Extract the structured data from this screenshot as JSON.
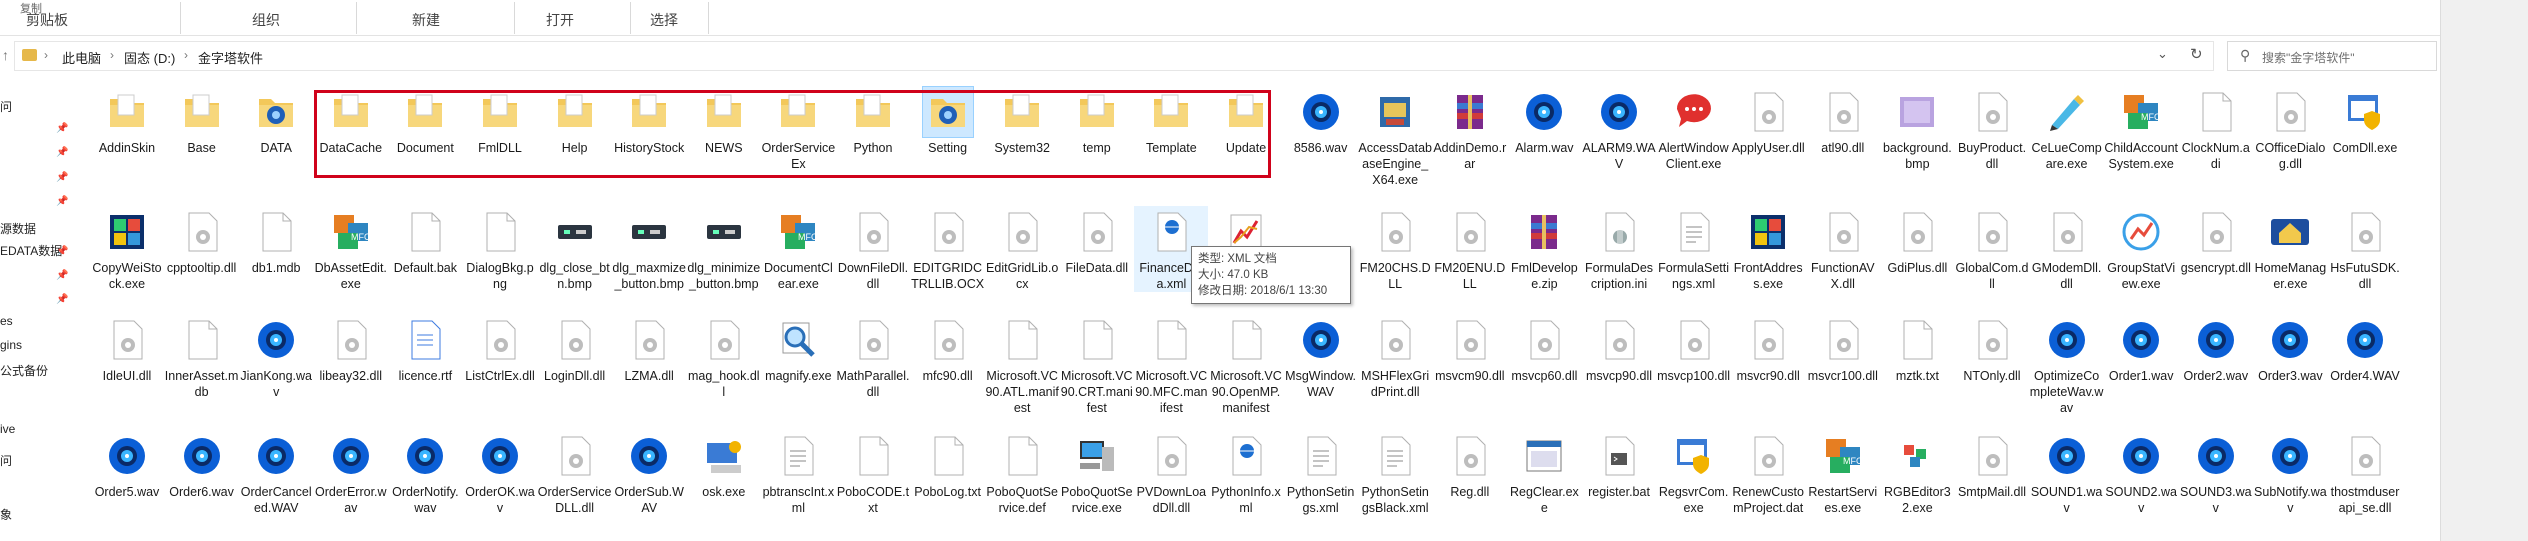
{
  "ribbon": {
    "groups": [
      "剪贴板",
      "组织",
      "新建",
      "打开",
      "选择"
    ],
    "stubs": [
      "复制"
    ]
  },
  "address": {
    "crumbs": [
      "此电脑",
      "固态 (D:)",
      "金字塔软件"
    ],
    "search_placeholder": "搜索\"金字塔软件\""
  },
  "nav": {
    "items": [
      "问",
      "源数据",
      "EDATA数据",
      "es",
      "gins",
      "公式备份",
      "ive",
      "问",
      "象"
    ]
  },
  "tooltip": {
    "line1": "类型: XML 文档",
    "line2": "大小: 47.0 KB",
    "line3": "修改日期: 2018/6/1 13:30"
  },
  "files": [
    {
      "name": "AddinSkin",
      "icon": "folder"
    },
    {
      "name": "Base",
      "icon": "folder"
    },
    {
      "name": "DATA",
      "icon": "folder-blue"
    },
    {
      "name": "DataCache",
      "icon": "folder"
    },
    {
      "name": "Document",
      "icon": "folder"
    },
    {
      "name": "FmlDLL",
      "icon": "folder"
    },
    {
      "name": "Help",
      "icon": "folder"
    },
    {
      "name": "HistoryStock",
      "icon": "folder"
    },
    {
      "name": "NEWS",
      "icon": "folder"
    },
    {
      "name": "OrderServiceEx",
      "icon": "folder"
    },
    {
      "name": "Python",
      "icon": "folder"
    },
    {
      "name": "Setting",
      "icon": "folder-blue",
      "selected": true
    },
    {
      "name": "System32",
      "icon": "folder"
    },
    {
      "name": "temp",
      "icon": "folder"
    },
    {
      "name": "Template",
      "icon": "folder"
    },
    {
      "name": "Update",
      "icon": "folder"
    },
    {
      "name": "8586.wav",
      "icon": "wav"
    },
    {
      "name": "AccessDatabaseEngine_X64.exe",
      "icon": "exe-installer"
    },
    {
      "name": "AddinDemo.rar",
      "icon": "rar"
    },
    {
      "name": "Alarm.wav",
      "icon": "wav"
    },
    {
      "name": "ALARM9.WAV",
      "icon": "wav"
    },
    {
      "name": "AlertWindowClient.exe",
      "icon": "exe-chat"
    },
    {
      "name": "ApplyUser.dll",
      "icon": "dll"
    },
    {
      "name": "atl90.dll",
      "icon": "dll"
    },
    {
      "name": "background.bmp",
      "icon": "bmp-purple"
    },
    {
      "name": "BuyProduct.dll",
      "icon": "dll"
    },
    {
      "name": "CeLueCompare.exe",
      "icon": "exe-pencil"
    },
    {
      "name": "ChildAccountSystem.exe",
      "icon": "exe-mfc"
    },
    {
      "name": "ClockNum.adi",
      "icon": "file"
    },
    {
      "name": "COfficeDialog.dll",
      "icon": "dll"
    },
    {
      "name": "ComDll.exe",
      "icon": "exe-shield"
    },
    {
      "name": "CopyWeiStock.exe",
      "icon": "exe-vs"
    },
    {
      "name": "cpptooltip.dll",
      "icon": "dll"
    },
    {
      "name": "db1.mdb",
      "icon": "file"
    },
    {
      "name": "DbAssetEdit.exe",
      "icon": "exe-mfc"
    },
    {
      "name": "Default.bak",
      "icon": "file"
    },
    {
      "name": "DialogBkg.png",
      "icon": "file"
    },
    {
      "name": "dlg_close_btn.bmp",
      "icon": "bmp-dark"
    },
    {
      "name": "dlg_maxmize_button.bmp",
      "icon": "bmp-dark"
    },
    {
      "name": "dlg_minimize_button.bmp",
      "icon": "bmp-dark"
    },
    {
      "name": "DocumentClear.exe",
      "icon": "exe-mfc"
    },
    {
      "name": "DownFileDll.dll",
      "icon": "dll"
    },
    {
      "name": "EDITGRIDCTRLLIB.OCX",
      "icon": "dll"
    },
    {
      "name": "EditGridLib.ocx",
      "icon": "dll"
    },
    {
      "name": "FileData.dll",
      "icon": "dll"
    },
    {
      "name": "FinanceData.xml",
      "icon": "xml",
      "hover": true
    },
    {
      "name": "",
      "icon": "chart"
    },
    {
      "name": "",
      "icon": "blank"
    },
    {
      "name": "FM20CHS.DLL",
      "icon": "dll"
    },
    {
      "name": "FM20ENU.DLL",
      "icon": "dll"
    },
    {
      "name": "FmlDevelope.zip",
      "icon": "rar"
    },
    {
      "name": "FormulaDescription.ini",
      "icon": "ini"
    },
    {
      "name": "FormulaSettings.xml",
      "icon": "xml-plain"
    },
    {
      "name": "FrontAddress.exe",
      "icon": "exe-vs"
    },
    {
      "name": "FunctionAVX.dll",
      "icon": "dll"
    },
    {
      "name": "GdiPlus.dll",
      "icon": "dll"
    },
    {
      "name": "GlobalCom.dll",
      "icon": "dll"
    },
    {
      "name": "GModemDll.dll",
      "icon": "dll"
    },
    {
      "name": "GroupStatView.exe",
      "icon": "exe-chart"
    },
    {
      "name": "gsencrypt.dll",
      "icon": "dll"
    },
    {
      "name": "HomeManager.exe",
      "icon": "exe-home"
    },
    {
      "name": "HsFutuSDK.dll",
      "icon": "dll"
    },
    {
      "name": "IdleUI.dll",
      "icon": "dll"
    },
    {
      "name": "InnerAsset.mdb",
      "icon": "file"
    },
    {
      "name": "JianKong.wav",
      "icon": "wav"
    },
    {
      "name": "libeay32.dll",
      "icon": "dll"
    },
    {
      "name": "licence.rtf",
      "icon": "rtf"
    },
    {
      "name": "ListCtrlEx.dll",
      "icon": "dll"
    },
    {
      "name": "LoginDll.dll",
      "icon": "dll"
    },
    {
      "name": "LZMA.dll",
      "icon": "dll"
    },
    {
      "name": "mag_hook.dll",
      "icon": "dll"
    },
    {
      "name": "magnify.exe",
      "icon": "exe-magnify"
    },
    {
      "name": "MathParallel.dll",
      "icon": "dll"
    },
    {
      "name": "mfc90.dll",
      "icon": "dll"
    },
    {
      "name": "Microsoft.VC90.ATL.manifest",
      "icon": "file"
    },
    {
      "name": "Microsoft.VC90.CRT.manifest",
      "icon": "file"
    },
    {
      "name": "Microsoft.VC90.MFC.manifest",
      "icon": "file"
    },
    {
      "name": "Microsoft.VC90.OpenMP.manifest",
      "icon": "file"
    },
    {
      "name": "MsgWindow.WAV",
      "icon": "wav"
    },
    {
      "name": "MSHFlexGridPrint.dll",
      "icon": "dll"
    },
    {
      "name": "msvcm90.dll",
      "icon": "dll"
    },
    {
      "name": "msvcp60.dll",
      "icon": "dll"
    },
    {
      "name": "msvcp90.dll",
      "icon": "dll"
    },
    {
      "name": "msvcp100.dll",
      "icon": "dll"
    },
    {
      "name": "msvcr90.dll",
      "icon": "dll"
    },
    {
      "name": "msvcr100.dll",
      "icon": "dll"
    },
    {
      "name": "mztk.txt",
      "icon": "file"
    },
    {
      "name": "NTOnly.dll",
      "icon": "dll"
    },
    {
      "name": "OptimizeCompleteWav.wav",
      "icon": "wav"
    },
    {
      "name": "Order1.wav",
      "icon": "wav"
    },
    {
      "name": "Order2.wav",
      "icon": "wav"
    },
    {
      "name": "Order3.wav",
      "icon": "wav"
    },
    {
      "name": "Order4.WAV",
      "icon": "wav"
    },
    {
      "name": "Order5.wav",
      "icon": "wav"
    },
    {
      "name": "Order6.wav",
      "icon": "wav"
    },
    {
      "name": "OrderCanceled.WAV",
      "icon": "wav"
    },
    {
      "name": "OrderError.wav",
      "icon": "wav"
    },
    {
      "name": "OrderNotify.wav",
      "icon": "wav"
    },
    {
      "name": "OrderOK.wav",
      "icon": "wav"
    },
    {
      "name": "OrderServiceDLL.dll",
      "icon": "dll"
    },
    {
      "name": "OrderSub.WAV",
      "icon": "wav"
    },
    {
      "name": "osk.exe",
      "icon": "exe-osk"
    },
    {
      "name": "pbtranscInt.xml",
      "icon": "xml-plain"
    },
    {
      "name": "PoboCODE.txt",
      "icon": "file"
    },
    {
      "name": "PoboLog.txt",
      "icon": "file"
    },
    {
      "name": "PoboQuotService.def",
      "icon": "file"
    },
    {
      "name": "PoboQuotService.exe",
      "icon": "exe-pc"
    },
    {
      "name": "PVDownLoadDll.dll",
      "icon": "dll"
    },
    {
      "name": "PythonInfo.xml",
      "icon": "xml"
    },
    {
      "name": "PythonSetings.xml",
      "icon": "xml-plain"
    },
    {
      "name": "PythonSetingsBlack.xml",
      "icon": "xml-plain"
    },
    {
      "name": "Reg.dll",
      "icon": "dll"
    },
    {
      "name": "RegClear.exe",
      "icon": "exe-window"
    },
    {
      "name": "register.bat",
      "icon": "bat"
    },
    {
      "name": "RegsvrCom.exe",
      "icon": "exe-shield"
    },
    {
      "name": "RenewCustomProject.dat",
      "icon": "dll"
    },
    {
      "name": "RestartServies.exe",
      "icon": "exe-mfc"
    },
    {
      "name": "RGBEditor32.exe",
      "icon": "exe-rgb"
    },
    {
      "name": "SmtpMail.dll",
      "icon": "dll"
    },
    {
      "name": "SOUND1.wav",
      "icon": "wav"
    },
    {
      "name": "SOUND2.wav",
      "icon": "wav"
    },
    {
      "name": "SOUND3.wav",
      "icon": "wav"
    },
    {
      "name": "SubNotify.wav",
      "icon": "wav"
    },
    {
      "name": "thostmduserapi_se.dll",
      "icon": "dll"
    }
  ]
}
